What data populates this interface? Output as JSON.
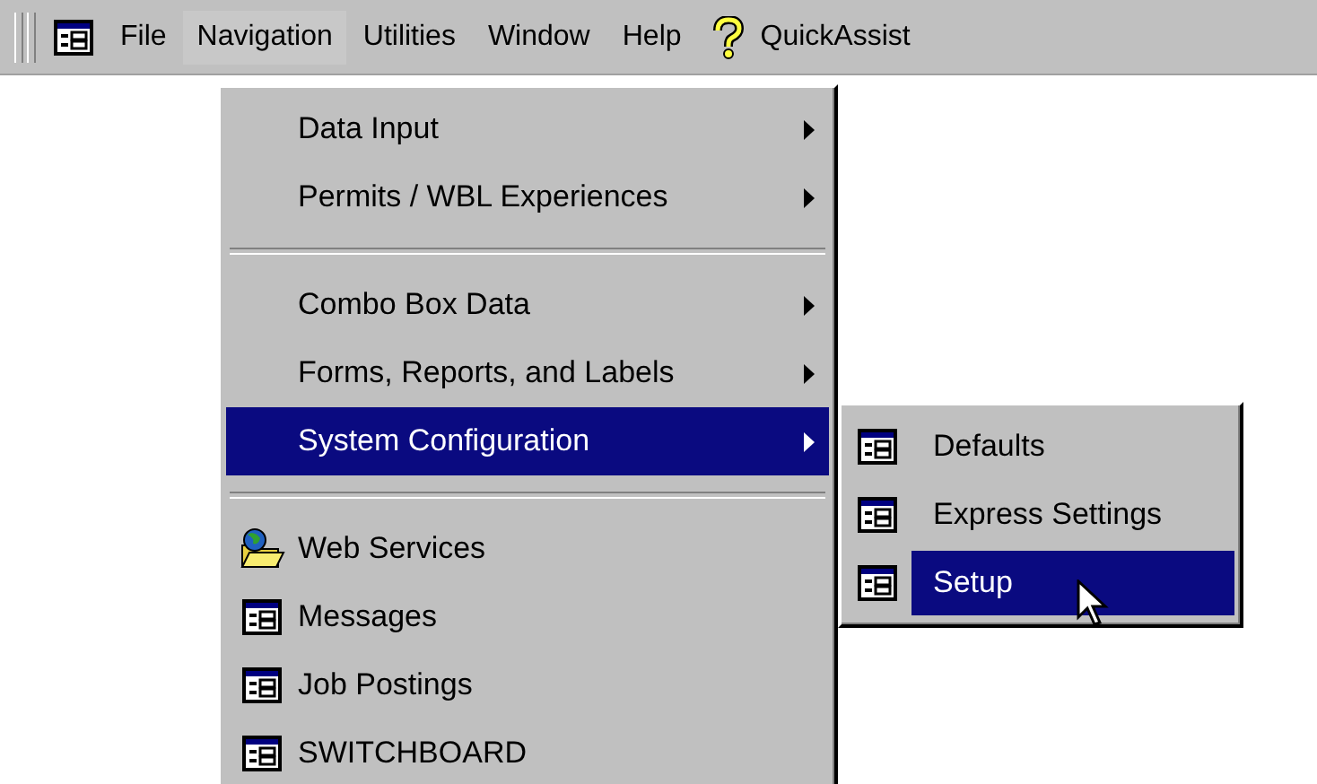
{
  "menu_bar": {
    "items": [
      {
        "kind": "menu",
        "label": "File",
        "selected": false
      },
      {
        "kind": "menu",
        "label": "Navigation",
        "selected": true
      },
      {
        "kind": "menu",
        "label": "Utilities",
        "selected": false
      },
      {
        "kind": "menu",
        "label": "Window",
        "selected": false
      },
      {
        "kind": "menu",
        "label": "Help",
        "selected": false
      },
      {
        "kind": "assist",
        "label": "QuickAssist",
        "selected": false
      }
    ]
  },
  "navigation_menu": {
    "items": [
      {
        "kind": "submenu",
        "label": "Data Input",
        "selected": false
      },
      {
        "kind": "submenu",
        "label": "Permits / WBL Experiences",
        "selected": false
      },
      {
        "kind": "separator"
      },
      {
        "kind": "submenu",
        "label": "Combo Box Data",
        "selected": false
      },
      {
        "kind": "submenu",
        "label": "Forms, Reports, and Labels",
        "selected": false
      },
      {
        "kind": "submenu",
        "label": "System Configuration",
        "selected": true
      },
      {
        "kind": "separator"
      },
      {
        "kind": "web",
        "label": "Web Services",
        "selected": false
      },
      {
        "kind": "form",
        "label": "Messages",
        "selected": false
      },
      {
        "kind": "form",
        "label": "Job Postings",
        "selected": false
      },
      {
        "kind": "form",
        "label": "SWITCHBOARD",
        "selected": false
      }
    ]
  },
  "system_configuration_submenu": {
    "items": [
      {
        "label": "Defaults",
        "selected": false
      },
      {
        "label": "Express Settings",
        "selected": false
      },
      {
        "label": "Setup",
        "selected": true
      }
    ]
  }
}
